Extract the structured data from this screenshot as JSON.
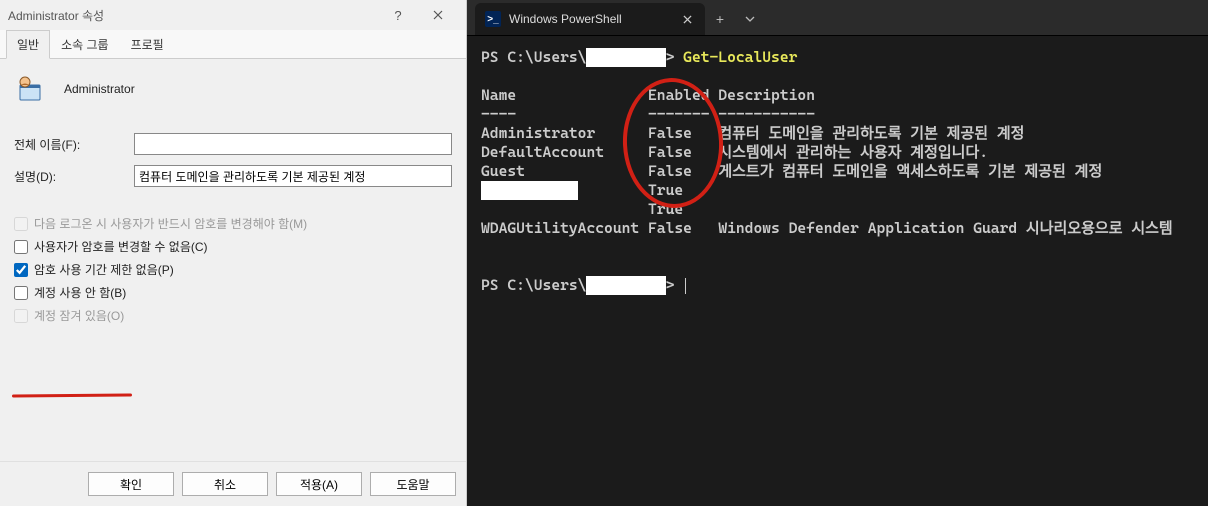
{
  "dialog": {
    "title": "Administrator 속성",
    "help": "?",
    "tabs": [
      "일반",
      "소속 그룹",
      "프로필"
    ],
    "active_tab": 0,
    "username": "Administrator",
    "fields": {
      "fullname_label": "전체 이름(F):",
      "fullname_value": "",
      "desc_label": "설명(D):",
      "desc_value": "컴퓨터 도메인을 관리하도록 기본 제공된 계정"
    },
    "checks": [
      {
        "label": "다음 로그온 시 사용자가 반드시 암호를 변경해야 함(M)",
        "checked": false,
        "disabled": true
      },
      {
        "label": "사용자가 암호를 변경할 수 없음(C)",
        "checked": false,
        "disabled": false
      },
      {
        "label": "암호 사용 기간 제한 없음(P)",
        "checked": true,
        "disabled": false
      },
      {
        "label": "계정 사용 안 함(B)",
        "checked": false,
        "disabled": false
      },
      {
        "label": "계정 잠겨 있음(O)",
        "checked": false,
        "disabled": true
      }
    ],
    "buttons": {
      "ok": "확인",
      "cancel": "취소",
      "apply": "적용(A)",
      "help": "도움말"
    }
  },
  "terminal": {
    "tab_title": "Windows PowerShell",
    "prompt_prefix": "PS C:\\Users\\",
    "prompt_suffix": "> ",
    "redacted": "        ",
    "command": "Get-LocalUser",
    "header": {
      "name": "Name",
      "enabled": "Enabled",
      "desc": "Description"
    },
    "sep": {
      "name": "----",
      "enabled": "-------",
      "desc": "-----------"
    },
    "rows": [
      {
        "name": "Administrator",
        "enabled": "False",
        "desc": "컴퓨터 도메인을 관리하도록 기본 제공된 계정"
      },
      {
        "name": "DefaultAccount",
        "enabled": "False",
        "desc": "시스템에서 관리하는 사용자 계정입니다."
      },
      {
        "name": "Guest",
        "enabled": "False",
        "desc": "게스트가 컴퓨터 도메인을 액세스하도록 기본 제공된 계정"
      },
      {
        "name": "__REDACTED__",
        "enabled": "True",
        "desc": ""
      },
      {
        "name": "",
        "enabled": "True",
        "desc": ""
      },
      {
        "name": "WDAGUtilityAccount",
        "enabled": "False",
        "desc": "Windows Defender Application Guard 시나리오용으로 시스템"
      }
    ]
  }
}
